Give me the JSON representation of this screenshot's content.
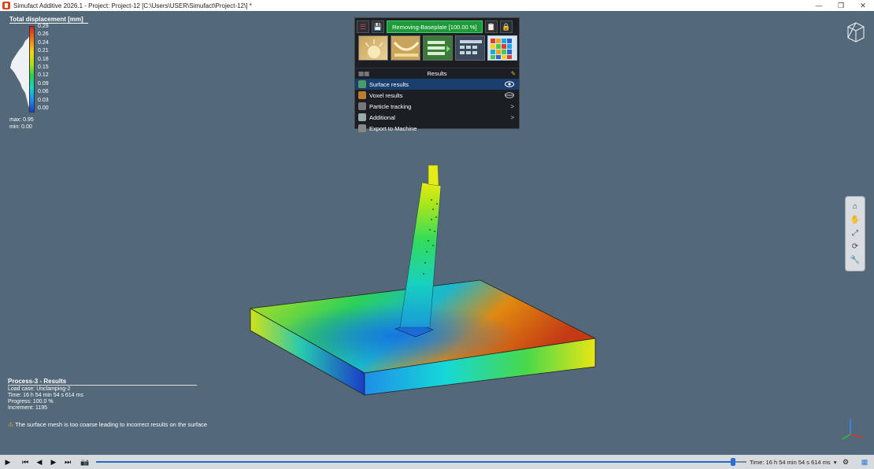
{
  "window": {
    "title": "Simufact Additive 2026.1 - Project: Project-12 [C:\\Users\\USER\\Simufact\\Project-12\\] *",
    "min_icon": "minimize-icon",
    "max_icon": "restore-icon",
    "close_icon": "close-icon"
  },
  "legend": {
    "title": "Total displacement [mm]",
    "ticks": [
      "0.29",
      "0.26",
      "0.24",
      "0.21",
      "0.18",
      "0.15",
      "0.12",
      "0.09",
      "0.06",
      "0.03",
      "0.00"
    ],
    "max": "max: 0.95",
    "min": "min: 0.00"
  },
  "toolbar": {
    "stage_label": "Removing-Baseplate [100.00 %]",
    "results_header": "Results",
    "result_items": [
      {
        "label": "Surface results",
        "right": "eye-icon",
        "selected": true
      },
      {
        "label": "Voxel results",
        "right": "eye-closed-icon",
        "selected": false
      },
      {
        "label": "Particle tracking",
        "right": ">",
        "selected": false
      },
      {
        "label": "Additional",
        "right": ">",
        "selected": false
      },
      {
        "label": "Export to Machine",
        "right": "",
        "selected": false
      }
    ]
  },
  "process": {
    "title": "Process-3 - Results",
    "load_case": "Load case: Unclamping-2",
    "time": "Time: 16 h 54 min 54 s 614 ms",
    "progress": "Progress: 100.0 %",
    "increment": "Increment: 1195"
  },
  "warning": {
    "text": "The surface mesh is too coarse leading to incorrect results on the surface"
  },
  "timeline": {
    "time_readout": "Time: 16 h 54 min 54 s 614 ms",
    "progress_fraction": 0.98
  },
  "colors": {
    "viewport_bg": "#536878",
    "accent_green": "#1f9a3a",
    "selection_blue": "#1a3e6e"
  }
}
